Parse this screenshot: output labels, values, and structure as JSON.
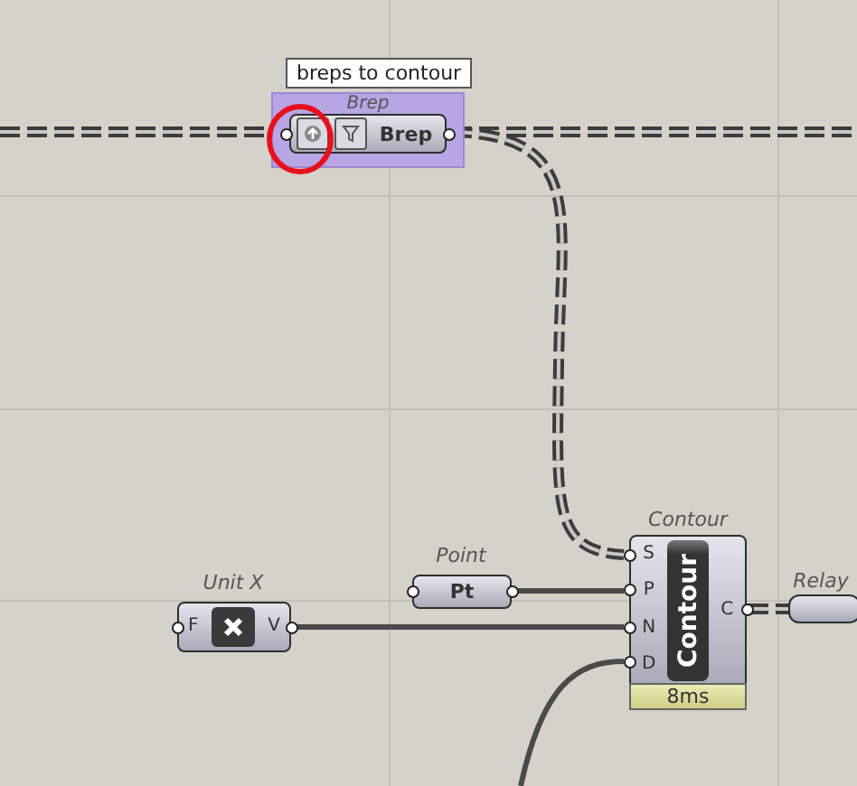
{
  "tooltip": "breps to contour",
  "brep": {
    "group_label": "Brep",
    "name": "Brep",
    "circled": true
  },
  "point": {
    "label": "Point",
    "name": "Pt"
  },
  "unit_x": {
    "label": "Unit X",
    "inputs": [
      "F"
    ],
    "outputs": [
      "V"
    ]
  },
  "contour": {
    "label": "Contour",
    "name": "Contour",
    "inputs": [
      "S",
      "P",
      "N",
      "D"
    ],
    "outputs": [
      "C"
    ],
    "timing": "8ms"
  },
  "relay": {
    "label": "Relay"
  }
}
